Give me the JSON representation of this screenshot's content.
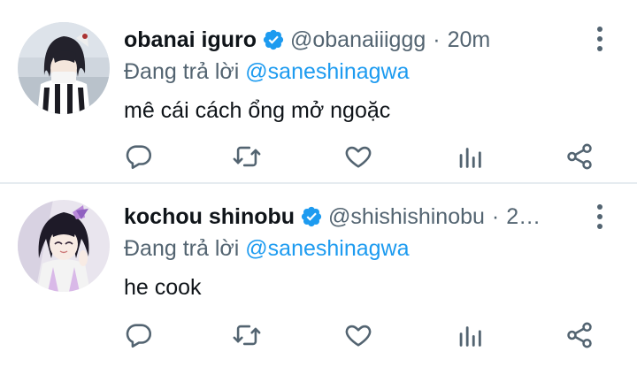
{
  "tweets": [
    {
      "name": "obanai iguro",
      "handle": "@obanaiiiggg",
      "separator": "·",
      "time": "20m",
      "reply_prefix": "Đang trả lời",
      "reply_to": "@saneshinagwa",
      "text": "mê cái cách ổng mở ngoặc"
    },
    {
      "name": "kochou shinobu",
      "handle": "@shishishinobu",
      "separator": "·",
      "time": "2…",
      "reply_prefix": "Đang trả lời",
      "reply_to": "@saneshinagwa",
      "text": "he cook"
    }
  ],
  "icons": {
    "reply": "reply-icon",
    "retweet": "retweet-icon",
    "like": "heart-icon",
    "analytics": "analytics-icon",
    "share": "share-icon",
    "more": "more-vertical-icon",
    "verified": "verified-badge-icon"
  },
  "colors": {
    "accent": "#1d9bf0",
    "secondary_text": "#536471",
    "divider": "#e6ecf0"
  }
}
